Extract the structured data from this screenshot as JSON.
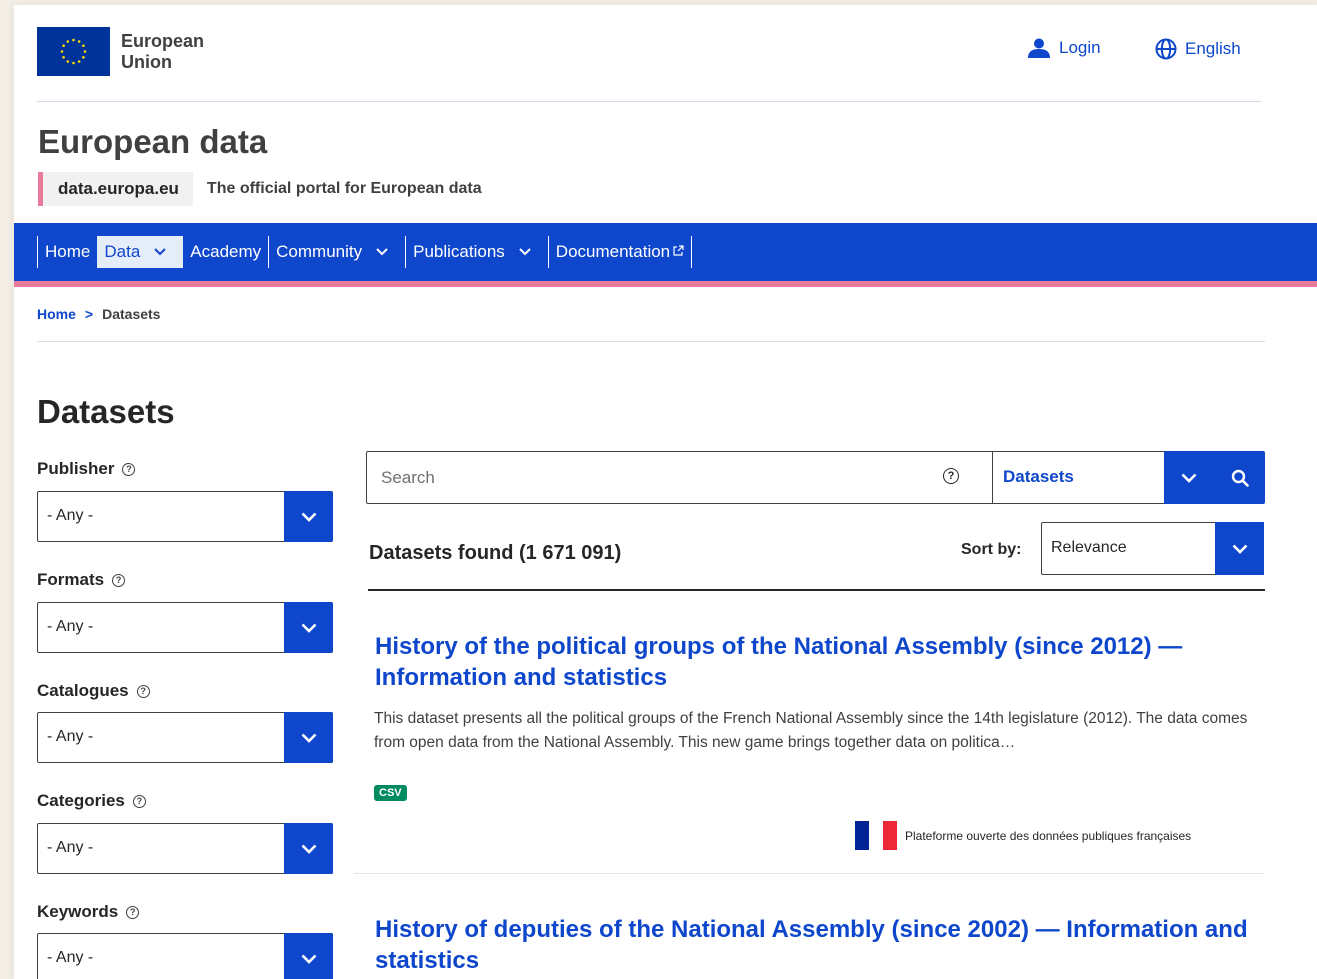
{
  "header": {
    "org_name_line1": "European",
    "org_name_line2": "Union",
    "login_label": "Login",
    "language_label": "English"
  },
  "site": {
    "title": "European data",
    "domain": "data.europa.eu",
    "tagline": "The official portal for European data"
  },
  "nav": {
    "items": [
      {
        "label": "Home"
      },
      {
        "label": "Data"
      },
      {
        "label": "Academy"
      },
      {
        "label": "Community"
      },
      {
        "label": "Publications"
      },
      {
        "label": "Documentation"
      }
    ]
  },
  "breadcrumb": {
    "home": "Home",
    "separator": ">",
    "current": "Datasets"
  },
  "page": {
    "heading": "Datasets"
  },
  "filters": [
    {
      "label": "Publisher",
      "value": "- Any -"
    },
    {
      "label": "Formats",
      "value": "- Any -"
    },
    {
      "label": "Catalogues",
      "value": "- Any -"
    },
    {
      "label": "Categories",
      "value": "- Any -"
    },
    {
      "label": "Keywords",
      "value": "- Any -"
    }
  ],
  "search": {
    "placeholder": "Search",
    "help_glyph": "?",
    "scope": "Datasets"
  },
  "results": {
    "found_text": "Datasets found (1 671 091)",
    "sort_label": "Sort by:",
    "sort_value": "Relevance",
    "items": [
      {
        "title": "History of the political groups of the National Assembly (since 2012) — Information and statistics",
        "description": "This dataset presents all the political groups of the French National Assembly since the 14th legislature (2012). The data comes from open data from the National Assembly. This new game brings together data on politica…",
        "format": "CSV",
        "publisher": "Plateforme ouverte des données publiques françaises"
      },
      {
        "title": "History of deputies of the National Assembly (since 2002) — Information and statistics"
      }
    ]
  },
  "colors": {
    "brand_blue": "#0e47cb",
    "accent_pink": "#e87b9a",
    "csv_green": "#008a5f",
    "flag_blue": "#002395",
    "flag_red": "#ED2939"
  },
  "icons": {
    "login": "user-icon",
    "language": "globe-icon",
    "dropdown": "chevron-down-icon",
    "search": "search-icon",
    "help": "help-circle-icon",
    "external": "external-link-icon"
  }
}
